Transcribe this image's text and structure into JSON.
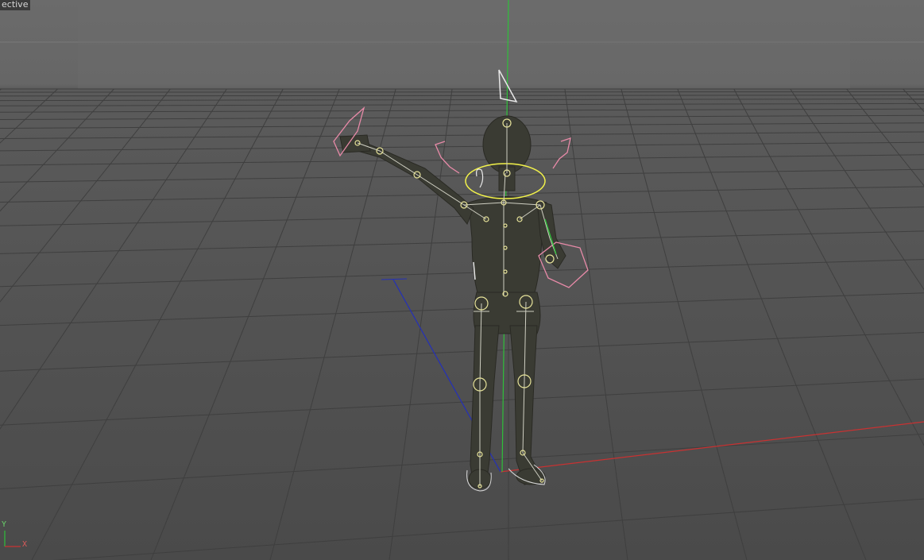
{
  "viewport": {
    "view_label": "Perspective",
    "view_label_visible": "ective",
    "axis_y_label": "Y",
    "axis_x_label": "X"
  },
  "colors": {
    "background_top": "#6b6b6b",
    "background_bottom": "#4a4a4a",
    "grid_line": "#3e3e3e",
    "axis_x": "#c83232",
    "axis_y": "#2fbf3a",
    "axis_z": "#2430b8",
    "joint": "#e7e39a",
    "selection": "#f2f24a",
    "ik_control": "#e88aa8",
    "figure": "#3a3b33"
  },
  "scene": {
    "object": "child-figure",
    "rig": "joint-skeleton"
  }
}
